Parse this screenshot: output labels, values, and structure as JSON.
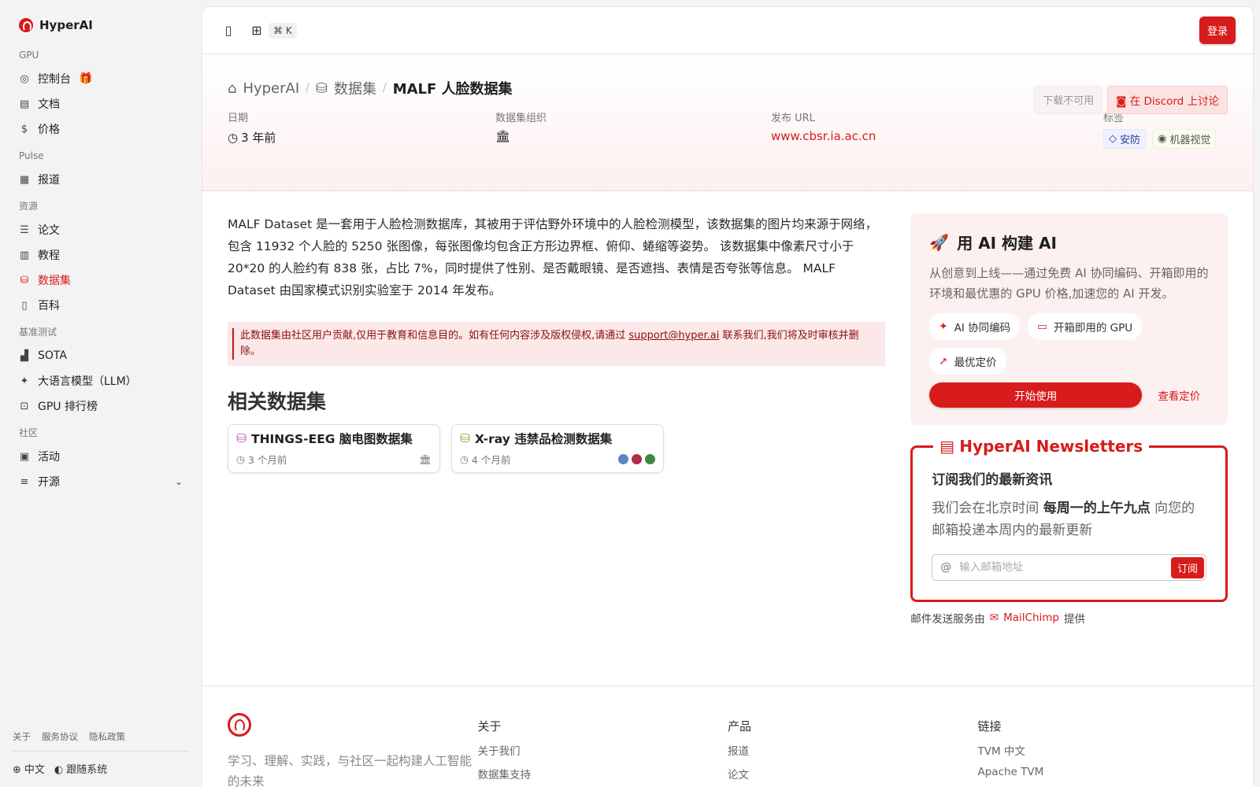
{
  "app": {
    "name": "HyperAI"
  },
  "sidebar": {
    "sections": [
      {
        "title": "GPU",
        "items": [
          {
            "label": "控制台",
            "icon": "dashboard-icon"
          },
          {
            "label": "文档",
            "icon": "book-icon"
          },
          {
            "label": "价格",
            "icon": "dollar-icon"
          }
        ]
      },
      {
        "title": "Pulse",
        "items": [
          {
            "label": "报道",
            "icon": "news-icon"
          }
        ]
      },
      {
        "title": "资源",
        "items": [
          {
            "label": "论文",
            "icon": "paper-icon"
          },
          {
            "label": "教程",
            "icon": "notebook-icon"
          },
          {
            "label": "数据集",
            "icon": "database-icon",
            "active": true
          },
          {
            "label": "百科",
            "icon": "book-open-icon"
          }
        ]
      },
      {
        "title": "基准测试",
        "items": [
          {
            "label": "SOTA",
            "icon": "chart-icon"
          },
          {
            "label": "大语言模型（LLM）",
            "icon": "sparkle-icon"
          },
          {
            "label": "GPU 排行榜",
            "icon": "cpu-icon"
          }
        ]
      },
      {
        "title": "社区",
        "items": [
          {
            "label": "活动",
            "icon": "calendar-icon"
          },
          {
            "label": "开源",
            "icon": "list-icon"
          }
        ]
      }
    ],
    "footer_links": [
      "关于",
      "服务协议",
      "隐私政策"
    ],
    "language": "中文",
    "theme": "跟随系统"
  },
  "topbar": {
    "shortcut": "⌘ K",
    "login": "登录"
  },
  "hero": {
    "breadcrumb": [
      "HyperAI",
      "数据集",
      "MALF 人脸数据集"
    ],
    "download_btn": "下载不可用",
    "discord_btn": "在 Discord 上讨论",
    "meta": {
      "date_label": "日期",
      "date_value": "3 年前",
      "org_label": "数据集组织",
      "url_label": "发布 URL",
      "url_value": "www.cbsr.ia.ac.cn",
      "tags_label": "标签",
      "tags": [
        "安防",
        "机器视觉"
      ]
    }
  },
  "content": {
    "description": "MALF Dataset 是一套用于人脸检测数据库，其被用于评估野外环境中的人脸检测模型，该数据集的图片均来源于网络，包含 11932 个人脸的 5250 张图像，每张图像均包含正方形边界框、俯仰、蜷缩等姿势。 该数据集中像素尺寸小于 20*20 的人脸约有 838 张，占比 7%，同时提供了性别、是否戴眼镜、是否遮挡、表情是否夸张等信息。 MALF Dataset 由国家模式识别实验室于 2014 年发布。",
    "notice_pre": "此数据集由社区用户贡献,仅用于教育和信息目的。如有任何内容涉及版权侵权,请通过 ",
    "notice_email": "support@hyper.ai",
    "notice_post": " 联系我们,我们将及时审核并删除。",
    "related_title": "相关数据集",
    "related": [
      {
        "title": "THINGS-EEG 脑电图数据集",
        "time": "3 个月前",
        "icon_color": "#c04fc0"
      },
      {
        "title": "X-ray 违禁品检测数据集",
        "time": "4 个月前",
        "icon_color": "#7fa52e"
      }
    ]
  },
  "promo": {
    "title": "用 AI 构建 AI",
    "text": "从创意到上线——通过免费 AI 协同编码、开箱即用的环境和最优惠的 GPU 价格,加速您的 AI 开发。",
    "chips": [
      "AI 协同编码",
      "开箱即用的 GPU",
      "最优定价"
    ],
    "start": "开始使用",
    "pricing": "查看定价"
  },
  "newsletter": {
    "title": "HyperAI Newsletters",
    "heading": "订阅我们的最新资讯",
    "text_pre": "我们会在北京时间 ",
    "text_bold": "每周一的上午九点",
    "text_post": " 向您的邮箱投递本周内的最新更新",
    "placeholder": "输入邮箱地址",
    "subscribe": "订阅",
    "powered_pre": "邮件发送服务由",
    "powered_brand": "MailChimp",
    "powered_post": "提供"
  },
  "footer": {
    "tagline": "学习、理解、实践，与社区一起构建人工智能的未来",
    "cols": [
      {
        "title": "关于",
        "links": [
          "关于我们",
          "数据集支持"
        ]
      },
      {
        "title": "产品",
        "links": [
          "报道",
          "论文"
        ]
      },
      {
        "title": "链接",
        "links": [
          "TVM 中文",
          "Apache TVM"
        ]
      }
    ]
  },
  "colors": {
    "accent": "#d81b1b",
    "sidebar_bg": "#f4f3f3",
    "hero_tint": "#fdf0f0"
  }
}
